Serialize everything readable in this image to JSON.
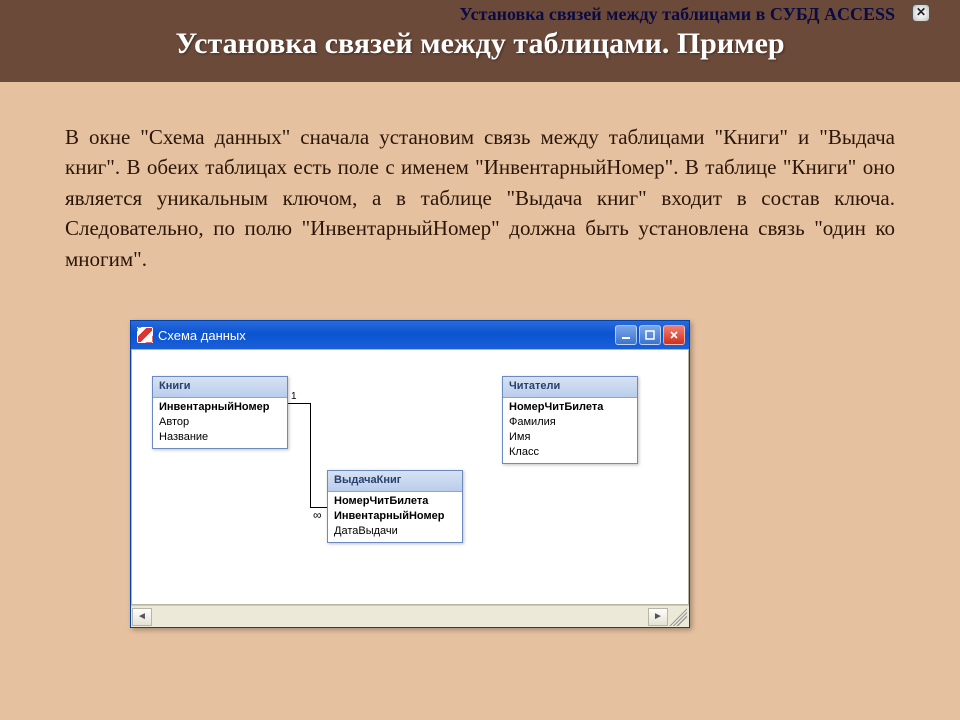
{
  "header": {
    "top_label": "Установка связей между таблицами в  СУБД ACCESS",
    "title": "Установка связей между таблицами. Пример",
    "close_glyph": "✕"
  },
  "body_text": "В окне \"Схема данных\" сначала установим связь между таблицами \"Книги\" и \"Выдача книг\". В обеих таблицах есть поле с именем \"ИнвентарныйНомер\". В таблице \"Книги\" оно является уникальным ключом, а в таблице \"Выдача книг\" входит в состав ключа. Следовательно, по полю  \"ИнвентарныйНомер\" должна быть установлена связь \"один ко многим\".",
  "access_window": {
    "title": "Схема данных",
    "tables": {
      "books": {
        "title": "Книги",
        "fields": [
          "ИнвентарныйНомер",
          "Автор",
          "Название"
        ],
        "key_indices": [
          0
        ]
      },
      "issue": {
        "title": "ВыдачаКниг",
        "fields": [
          "НомерЧитБилета",
          "ИнвентарныйНомер",
          "ДатаВыдачи"
        ],
        "key_indices": [
          0,
          1
        ]
      },
      "readers": {
        "title": "Читатели",
        "fields": [
          "НомерЧитБилета",
          "Фамилия",
          "Имя",
          "Класс"
        ],
        "key_indices": [
          0
        ]
      }
    },
    "relation": {
      "one_label": "1",
      "many_label": "∞"
    },
    "scroll": {
      "left": "◄",
      "right": "►"
    }
  }
}
